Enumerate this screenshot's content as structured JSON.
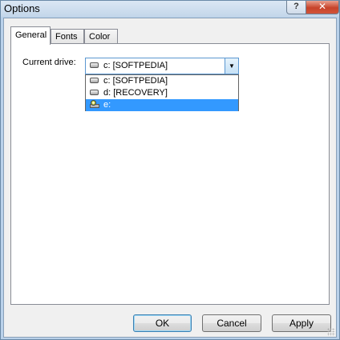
{
  "window": {
    "title": "Options",
    "help_glyph": "?",
    "close_glyph": "✕"
  },
  "tabs": [
    {
      "label": "General",
      "active": true
    },
    {
      "label": "Fonts",
      "active": false
    },
    {
      "label": "Color",
      "active": false
    }
  ],
  "general": {
    "drive_label": "Current drive:",
    "selected_drive": "c: [SOFTPEDIA]",
    "dropdown_arrow": "▼",
    "options": [
      {
        "label": "c: [SOFTPEDIA]",
        "icon": "hard-drive-icon"
      },
      {
        "label": "d: [RECOVERY]",
        "icon": "hard-drive-icon"
      },
      {
        "label": "e:",
        "icon": "cd-drive-icon",
        "highlighted": true
      }
    ]
  },
  "buttons": {
    "ok": "OK",
    "cancel": "Cancel",
    "apply": "Apply"
  },
  "colors": {
    "selection": "#3399ff",
    "window_frame": "#b9d1ea",
    "close_button": "#c7432a"
  }
}
